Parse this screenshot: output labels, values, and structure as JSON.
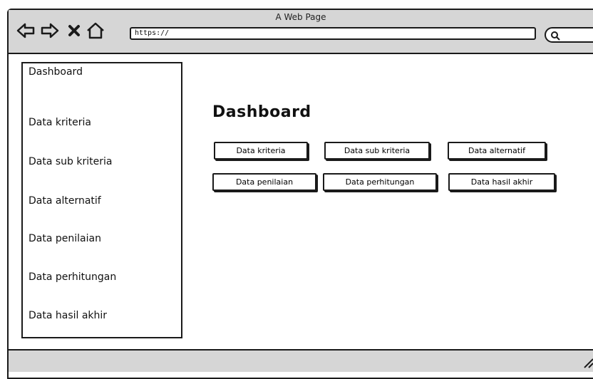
{
  "window": {
    "title": "A Web Page"
  },
  "toolbar": {
    "back_icon": "back-arrow-icon",
    "forward_icon": "forward-arrow-icon",
    "close_icon": "close-icon",
    "home_icon": "home-icon",
    "url": "https://",
    "search_icon": "search-icon"
  },
  "sidebar": {
    "items": [
      {
        "label": "Dashboard"
      },
      {
        "label": "Data kriteria"
      },
      {
        "label": "Data sub kriteria"
      },
      {
        "label": "Data alternatif"
      },
      {
        "label": "Data penilaian"
      },
      {
        "label": "Data perhitungan"
      },
      {
        "label": "Data hasil akhir"
      }
    ]
  },
  "main": {
    "title": "Dashboard",
    "buttons": [
      {
        "label": "Data kriteria"
      },
      {
        "label": "Data sub kriteria"
      },
      {
        "label": "Data alternatif"
      },
      {
        "label": "Data penilaian"
      },
      {
        "label": "Data perhitungan"
      },
      {
        "label": "Data hasil akhir"
      }
    ]
  },
  "colors": {
    "chrome": "#d6d6d6",
    "stroke": "#1a1a1a",
    "background": "#ffffff"
  }
}
